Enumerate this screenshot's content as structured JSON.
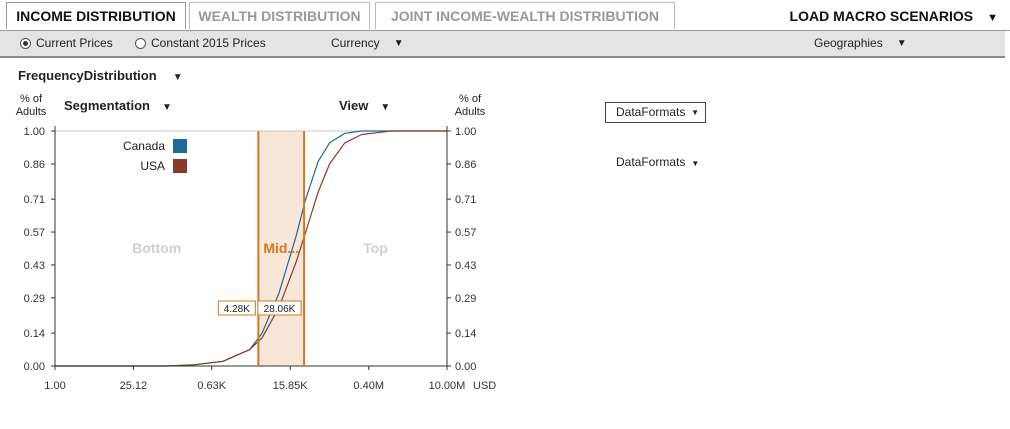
{
  "tabs": [
    "INCOME DISTRIBUTION",
    "WEALTH DISTRIBUTION",
    "JOINT INCOME-WEALTH DISTRIBUTION"
  ],
  "load_macro": {
    "label": "LOAD MACRO SCENARIOS",
    "arrow": "▼"
  },
  "toolbar": {
    "current_prices": "Current Prices",
    "constant_prices": "Constant 2015 Prices",
    "selected_price": "Current Prices",
    "currency": "Currency",
    "geographies": "Geographies"
  },
  "freq_dist": "FrequencyDistribution",
  "segmentation": "Segmentation",
  "view": "View",
  "dataformats_box": "DataFormats",
  "dataformats_plain": "DataFormats",
  "axis": {
    "left_title_line1": "% of",
    "left_title_line2": "Adults",
    "right_title_line1": "% of",
    "right_title_line2": "Adults",
    "unit": "USD"
  },
  "chart_data": {
    "type": "line",
    "xscale": "log",
    "xlim": [
      1,
      10000000
    ],
    "ylim": [
      0,
      1
    ],
    "y_ticks": [
      "0.00",
      "0.14",
      "0.29",
      "0.43",
      "0.57",
      "0.71",
      "0.86",
      "1.00"
    ],
    "x_ticks": [
      {
        "label": "1.00",
        "value": 1
      },
      {
        "label": "25.12",
        "value": 25.12
      },
      {
        "label": "0.63K",
        "value": 630
      },
      {
        "label": "15.85K",
        "value": 15850
      },
      {
        "label": "0.40M",
        "value": 400000
      },
      {
        "label": "10.00M",
        "value": 10000000
      }
    ],
    "legend": [
      {
        "name": "Canada",
        "color": "#1f6a9a"
      },
      {
        "name": "USA",
        "color": "#8a3a2a"
      }
    ],
    "series": [
      {
        "name": "Canada",
        "color": "#1f6a9a",
        "x": [
          1,
          100,
          300,
          1000,
          3000,
          5000,
          10000,
          20000,
          30000,
          50000,
          80000,
          150000,
          300000,
          1000000,
          10000000
        ],
        "y": [
          0,
          0.0,
          0.005,
          0.02,
          0.07,
          0.14,
          0.31,
          0.55,
          0.71,
          0.87,
          0.95,
          0.99,
          1.0,
          1.0,
          1.0
        ]
      },
      {
        "name": "USA",
        "color": "#8a3a2a",
        "x": [
          1,
          100,
          300,
          1000,
          3000,
          5000,
          10000,
          20000,
          30000,
          50000,
          80000,
          150000,
          300000,
          1000000,
          10000000
        ],
        "y": [
          0,
          0.0,
          0.005,
          0.02,
          0.07,
          0.12,
          0.25,
          0.44,
          0.57,
          0.74,
          0.86,
          0.95,
          0.985,
          1.0,
          1.0
        ]
      }
    ],
    "segments": [
      {
        "label": "Bottom",
        "from": 1,
        "to": 4280
      },
      {
        "label": "Mid...",
        "from": 4280,
        "to": 28060
      },
      {
        "label": "Top",
        "from": 28060,
        "to": 10000000
      }
    ],
    "thresholds": [
      {
        "label": "4.28K",
        "value": 4280
      },
      {
        "label": "28.06K",
        "value": 28060
      }
    ],
    "colors": {
      "highlight": "#d4781e",
      "band": "#f8e6d8",
      "segment_text": "#cfcfcf",
      "grid": "#999999"
    }
  }
}
